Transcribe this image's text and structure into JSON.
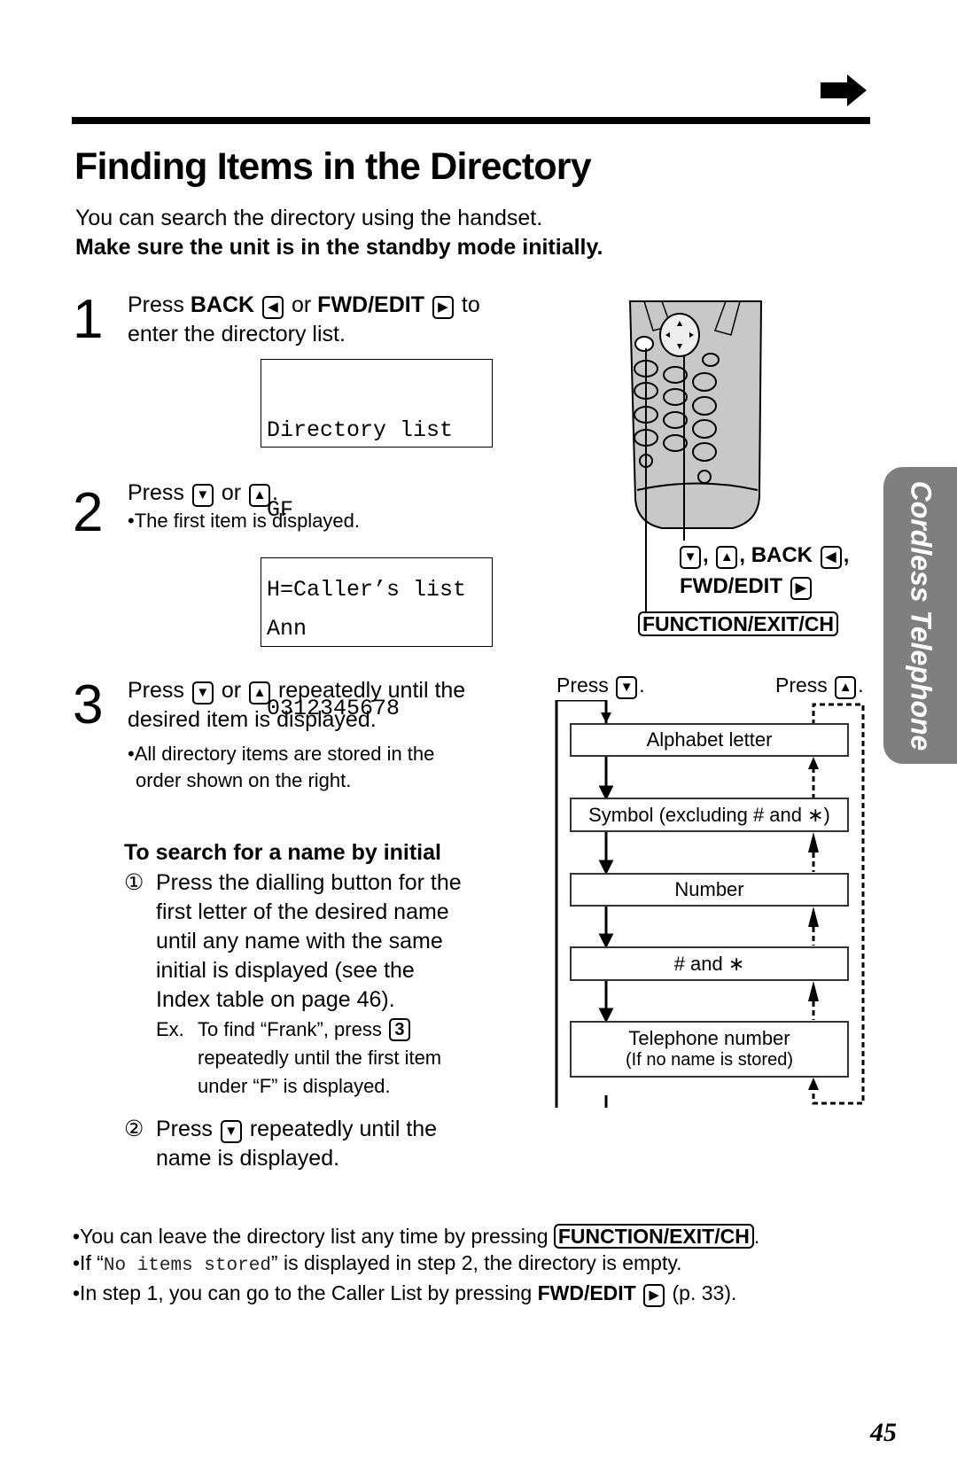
{
  "page": {
    "title": "Finding Items in the Directory",
    "intro_text": "You can search the directory using the handset.",
    "intro_bold": "Make sure the unit is in the standby mode initially.",
    "section_tab": "Cordless Telephone",
    "page_number": "45",
    "continue_icon": "arrow-right-icon"
  },
  "steps": [
    {
      "number": "1",
      "parts": {
        "press": "Press",
        "back": "BACK",
        "back_key": "◀",
        "or": "or",
        "fwd": "FWD/EDIT",
        "fwd_key": "▶",
        "to": "to",
        "line2": "enter the directory list."
      },
      "display": [
        "Directory list",
        "GF",
        "H=Caller’s list"
      ]
    },
    {
      "number": "2",
      "parts": {
        "press": "Press",
        "down_key": "▼",
        "or": "or",
        "up_key": "▲",
        "end": ".",
        "bullet": "•The first item is displayed."
      },
      "display": [
        "Ann",
        "0312345678"
      ]
    },
    {
      "number": "3",
      "parts": {
        "press": "Press",
        "down_key": "▼",
        "or": "or",
        "up_key": "▲",
        "rest": "repeatedly until the",
        "line2": "desired item is displayed.",
        "bullet_line1": "•All directory items are stored in the",
        "bullet_line2": "order shown on the right."
      }
    }
  ],
  "search_by_initial": {
    "heading": "To search for a name by initial",
    "item1_marker": "①",
    "item1_lines": [
      "Press the dialling button for the",
      "first letter of the desired name",
      "until any name with the same",
      "initial is displayed (see the",
      "Index table on page 46)."
    ],
    "example_prefix": "Ex.",
    "example_line1": "To find “Frank”, press",
    "example_key": "3",
    "example_line2": "repeatedly until the first item",
    "example_line3": "under “F” is displayed.",
    "item2_marker": "②",
    "item2_press": "Press",
    "item2_key": "▼",
    "item2_rest": "repeatedly until the",
    "item2_line2": "name is displayed."
  },
  "handset_callouts": {
    "down_key": "▼",
    "up_key": "▲",
    "back": "BACK",
    "back_key": "◀",
    "fwd": "FWD/EDIT",
    "fwd_key": "▶",
    "function_key": "FUNCTION/EXIT/CH"
  },
  "flow": {
    "press_down_label": "Press",
    "press_down_key": "▼",
    "press_up_label": "Press",
    "press_up_key": "▲",
    "items": [
      {
        "label": "Alphabet letter"
      },
      {
        "label": "Symbol (excluding # and ∗)"
      },
      {
        "label": "Number"
      },
      {
        "label": "# and ∗"
      },
      {
        "label": "Telephone number",
        "sub": "(If no name is stored)"
      }
    ]
  },
  "notes": {
    "note1_text": "•You can leave the directory list any time by pressing",
    "note1_key": "FUNCTION/EXIT/CH",
    "note1_end": ".",
    "note2_pre": "•If “",
    "note2_mono": "No items stored",
    "note2_post": "” is displayed in step 2, the directory is empty.",
    "note3_pre": "•In step 1, you can go to the Caller List by pressing",
    "note3_bold": "FWD/EDIT",
    "note3_key": "▶",
    "note3_post": "(p. 33)."
  }
}
